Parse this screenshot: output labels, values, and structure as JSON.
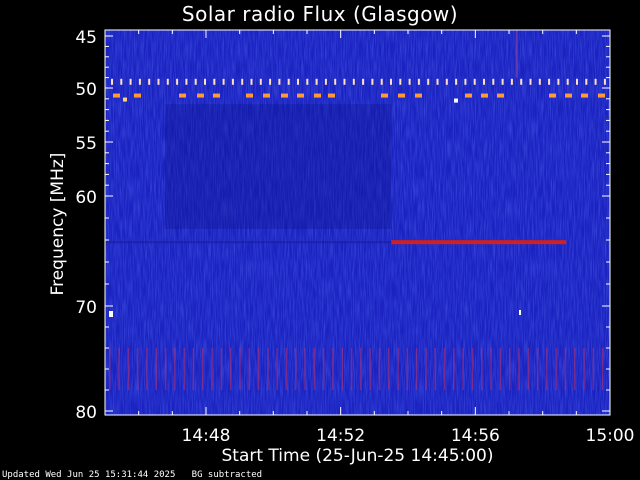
{
  "chart_data": {
    "type": "heatmap",
    "title": "Solar radio Flux (Glasgow)",
    "xlabel": "Start Time (25-Jun-25 14:45:00)",
    "ylabel": "Frequency [MHz]",
    "x_ticks": [
      "14:48",
      "14:52",
      "14:56",
      "15:00"
    ],
    "y_ticks": [
      "45",
      "50",
      "55",
      "60",
      "70",
      "80"
    ],
    "x_range_minutes": [
      0,
      15
    ],
    "y_range_mhz": [
      44,
      80
    ],
    "y_scale": "log-like (frequency axis)",
    "background_color": "#1420b8",
    "features": [
      {
        "name": "interference-line-49.5MHz",
        "freq_mhz": 49.5,
        "color": "#ffe0c0"
      },
      {
        "name": "interference-line-50.7MHz",
        "freq_mhz": 50.7,
        "color": "#ff9a3a"
      },
      {
        "name": "persistent-emission-64MHz",
        "freq_mhz": 64.2,
        "start_min": 8.5,
        "end_min": 13.7,
        "color": "#d0201f"
      },
      {
        "name": "banded-interference-74-78MHz",
        "freq_mhz_range": [
          74,
          78
        ],
        "color": "#c03060"
      }
    ]
  },
  "footer": {
    "updated": "Updated Wed Jun 25 15:31:44 2025",
    "bg_note": "BG subtracted"
  }
}
